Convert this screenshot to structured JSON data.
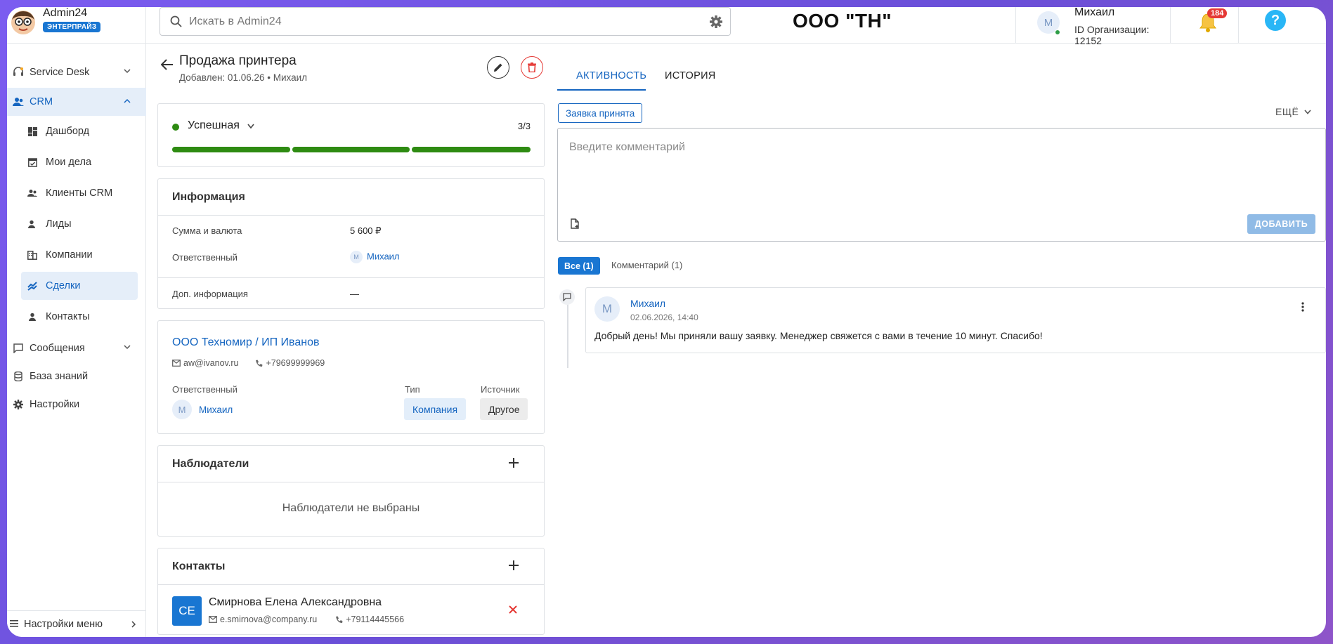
{
  "app": {
    "name": "Admin24",
    "edition": "ЭНТЕРПРАЙЗ"
  },
  "search": {
    "placeholder": "Искать в Admin24"
  },
  "header": {
    "org_title": "ООО \"ТН\"",
    "user_initial": "М",
    "user_name": "Михаил",
    "org_id": "ID Организации: 12152",
    "notifications": "184",
    "help": "?"
  },
  "sidebar": {
    "items": [
      {
        "label": "Service Desk",
        "icon": "headset-icon"
      },
      {
        "label": "CRM",
        "icon": "people-icon"
      },
      {
        "label": "Сообщения",
        "icon": "chat-icon"
      },
      {
        "label": "База знаний",
        "icon": "database-icon"
      },
      {
        "label": "Настройки",
        "icon": "gear-icon"
      }
    ],
    "crm_sub": [
      {
        "label": "Дашборд",
        "icon": "dashboard-icon"
      },
      {
        "label": "Мои дела",
        "icon": "calendar-check-icon"
      },
      {
        "label": "Клиенты CRM",
        "icon": "clients-icon"
      },
      {
        "label": "Лиды",
        "icon": "person-icon"
      },
      {
        "label": "Компании",
        "icon": "building-icon"
      },
      {
        "label": "Сделки",
        "icon": "handshake-icon"
      },
      {
        "label": "Контакты",
        "icon": "contact-icon"
      }
    ],
    "footer": "Настройки меню"
  },
  "deal": {
    "title": "Продажа принтера",
    "subtitle": "Добавлен: 01.06.26 • Михаил",
    "stage": "Успешная",
    "stage_count": "3/3",
    "stage_progress": 1.0,
    "stage_color": "#2e8b12"
  },
  "info": {
    "title": "Информация",
    "rows": [
      {
        "label": "Сумма и валюта",
        "value": "5 600 ₽"
      },
      {
        "label": "Ответственный",
        "value": "Михаил",
        "initial": "М"
      },
      {
        "label": "Доп. информация",
        "value": "—"
      }
    ]
  },
  "company": {
    "name": "ООО Техномир / ИП Иванов",
    "email": "aw@ivanov.ru",
    "phone": "+79699999969",
    "resp_label": "Ответственный",
    "type_label": "Тип",
    "source_label": "Источник",
    "resp_name": "Михаил",
    "resp_initial": "М",
    "type_value": "Компания",
    "source_value": "Другое"
  },
  "watchers": {
    "title": "Наблюдатели",
    "empty": "Наблюдатели не выбраны"
  },
  "contacts": {
    "title": "Контакты",
    "items": [
      {
        "initials": "СЕ",
        "name": "Смирнова Елена Александровна",
        "email": "e.smirnova@company.ru",
        "phone": "+79114445566"
      }
    ]
  },
  "activity": {
    "tabs": [
      "АКТИВНОСТЬ",
      "ИСТОРИЯ"
    ],
    "status": "Заявка принята",
    "more": "ЕЩЁ",
    "comment_placeholder": "Введите комментарий",
    "add_button": "ДОБАВИТЬ",
    "filters": [
      "Все (1)",
      "Комментарий (1)"
    ],
    "comments": [
      {
        "initial": "М",
        "author": "Михаил",
        "time": "02.06.2026, 14:40",
        "text": "Добрый день! Мы приняли вашу заявку. Менеджер свяжется с вами в течение 10 минут. Спасибо!"
      }
    ]
  },
  "colors": {
    "accent": "#1565c0",
    "success": "#2e8b12",
    "danger": "#e53935"
  }
}
